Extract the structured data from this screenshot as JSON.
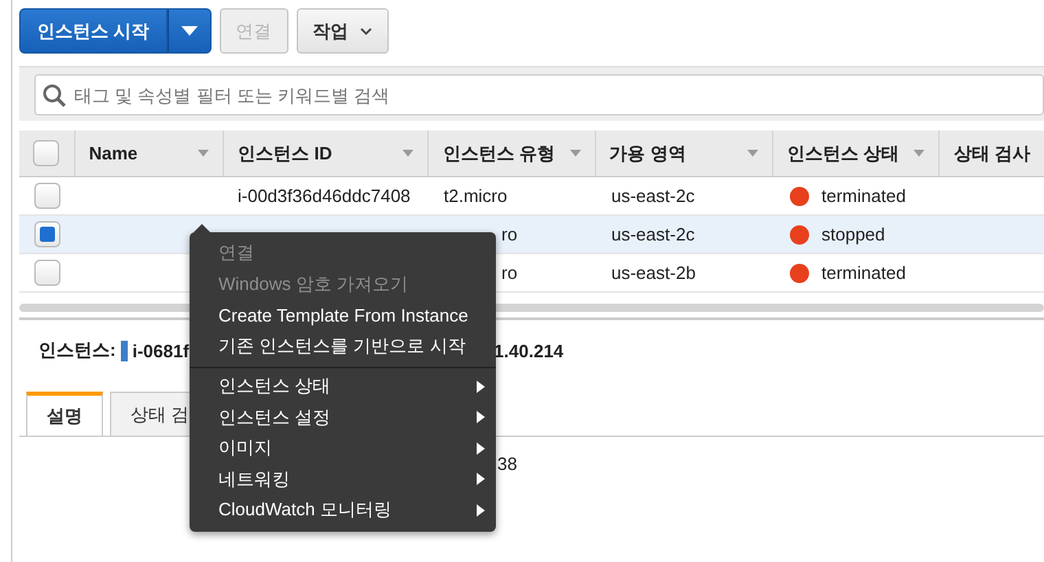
{
  "toolbar": {
    "launch_button": "인스턴스 시작",
    "connect_button": {
      "label": "연결",
      "disabled": true
    },
    "actions_button": "작업"
  },
  "search": {
    "placeholder": "태그 및 속성별 필터 또는 키워드별 검색"
  },
  "table": {
    "all_selected": false,
    "columns": [
      "Name",
      "인스턴스 ID",
      "인스턴스 유형",
      "가용 영역",
      "인스턴스 상태",
      "상태 검사"
    ],
    "rows": [
      {
        "selected": false,
        "name": "",
        "id": "i-00d3f36d46ddc7408",
        "type": "t2.micro",
        "type_partial": false,
        "zone": "us-east-2c",
        "state": "terminated",
        "color": "#e8401c"
      },
      {
        "selected": true,
        "name": "",
        "id": "",
        "type": "ro",
        "type_partial": true,
        "zone": "us-east-2c",
        "state": "stopped",
        "color": "#e8401c"
      },
      {
        "selected": false,
        "name": "",
        "id": "",
        "type": "ro",
        "type_partial": true,
        "zone": "us-east-2b",
        "state": "terminated",
        "color": "#e8401c"
      }
    ]
  },
  "detail": {
    "label": "인스턴스:",
    "instance_id": "i-0681f",
    "ip_fragment": "1.40.214",
    "tabs": [
      {
        "label": "설명",
        "selected": true
      },
      {
        "label": "상태 검",
        "selected": false
      }
    ],
    "value_fragment": "38"
  },
  "context_menu": {
    "items": [
      {
        "kind": "item",
        "label": "연결",
        "disabled": true
      },
      {
        "kind": "item",
        "label": "Windows 암호 가져오기",
        "disabled": true
      },
      {
        "kind": "item",
        "label": "Create Template From Instance",
        "disabled": false
      },
      {
        "kind": "item",
        "label": "기존 인스턴스를 기반으로 시작",
        "disabled": false
      },
      {
        "kind": "separator"
      },
      {
        "kind": "submenu",
        "label": "인스턴스 상태",
        "disabled": false
      },
      {
        "kind": "submenu",
        "label": "인스턴스 설정",
        "disabled": false
      },
      {
        "kind": "submenu",
        "label": "이미지",
        "disabled": false
      },
      {
        "kind": "submenu",
        "label": "네트워킹",
        "disabled": false
      },
      {
        "kind": "submenu",
        "label": "CloudWatch 모니터링",
        "disabled": false
      }
    ]
  }
}
